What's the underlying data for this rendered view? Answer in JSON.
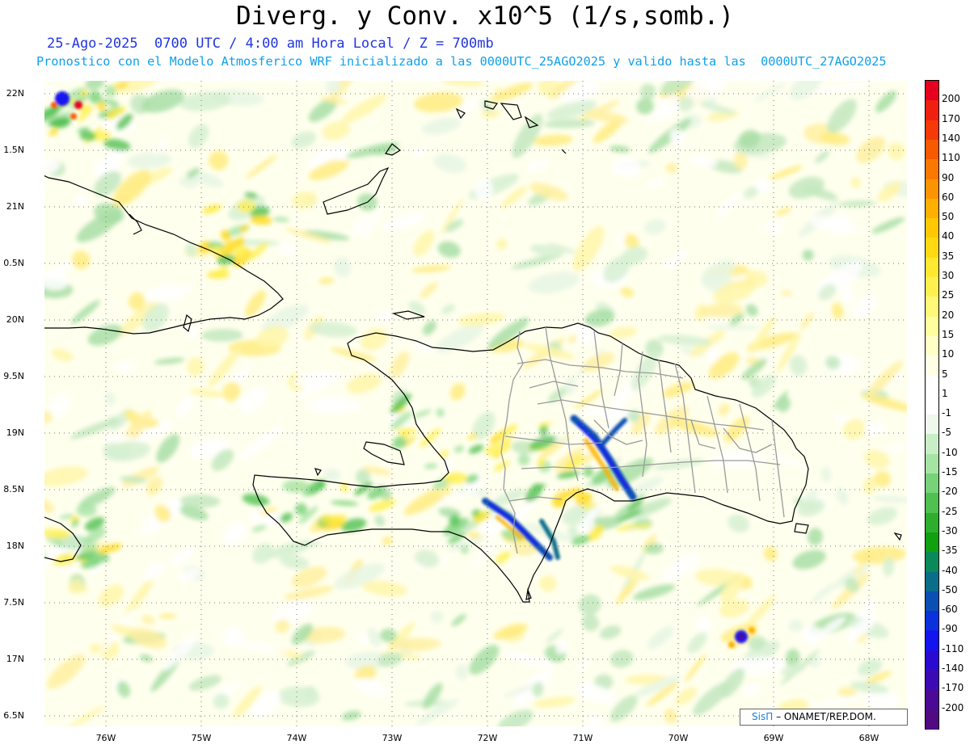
{
  "title": "Diverg. y Conv. x10^5 (1/s,somb.)",
  "subtitle_1": "25-Ago-2025  0700 UTC / 4:00 am Hora Local / Z = 700mb",
  "subtitle_2": "Pronostico con el Modelo Atmosferico WRF inicializado a las 0000UTC_25AGO2025 y valido hasta las  0000UTC_27AGO2025",
  "credit": {
    "brand": "SisΠ",
    "text": "– ONAMET/REP.DOM."
  },
  "axes": {
    "lat_labels": [
      "22N",
      "1.5N",
      "21N",
      "0.5N",
      "20N",
      "9.5N",
      "19N",
      "8.5N",
      "18N",
      "7.5N",
      "17N",
      "6.5N"
    ],
    "lon_labels": [
      "76W",
      "75W",
      "74W",
      "73W",
      "72W",
      "71W",
      "70W",
      "69W",
      "68W"
    ]
  },
  "colorbar": {
    "labels": [
      "200",
      "170",
      "140",
      "110",
      "90",
      "60",
      "50",
      "40",
      "35",
      "30",
      "25",
      "20",
      "15",
      "10",
      "5",
      "1",
      "-1",
      "-5",
      "-10",
      "-15",
      "-20",
      "-25",
      "-30",
      "-35",
      "-40",
      "-50",
      "-60",
      "-90",
      "-110",
      "-140",
      "-170",
      "-200"
    ],
    "colors": [
      "#e6001e",
      "#f02010",
      "#f53a08",
      "#f85a00",
      "#fa7800",
      "#fc9400",
      "#fdb000",
      "#ffc800",
      "#ffda10",
      "#ffe830",
      "#fff050",
      "#fff878",
      "#ffffa0",
      "#ffffc8",
      "#ffffe6",
      "#ffffff",
      "#ffffff",
      "#f0f8ee",
      "#c8eec6",
      "#a6e4a4",
      "#78d278",
      "#50c050",
      "#2eae2e",
      "#10a010",
      "#0a8a5a",
      "#0a6e8a",
      "#0a50b4",
      "#0a32dc",
      "#1414f0",
      "#2a0ad2",
      "#3c0ab4",
      "#4b0a96",
      "#500a82"
    ]
  },
  "map_features": [
    "hispaniola-coast",
    "haiti-dr-border",
    "dr-provinces",
    "cuba-coast",
    "jamaica-coast",
    "bahamas-coast",
    "puerto-rico-coast",
    "convergence-bands",
    "divergence-bands"
  ]
}
